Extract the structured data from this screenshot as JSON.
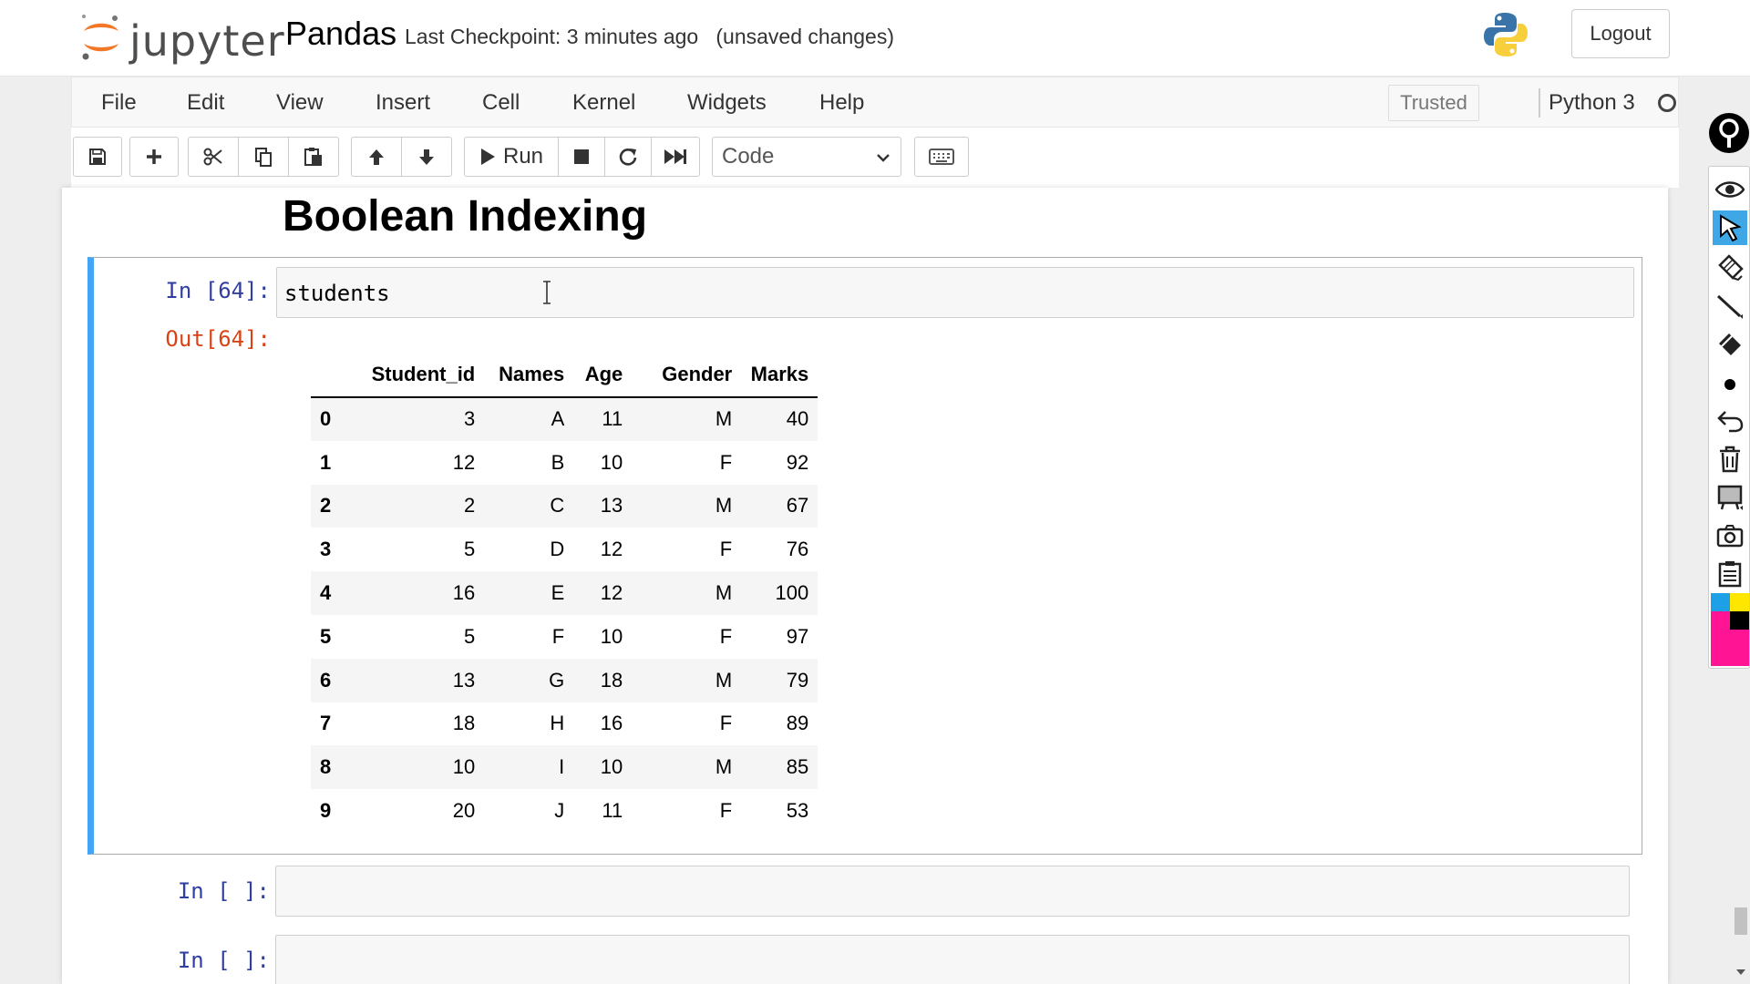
{
  "header": {
    "logo_text": "jupyter",
    "notebook_name": "Pandas",
    "checkpoint": "Last Checkpoint: 3 minutes ago",
    "unsaved": "(unsaved changes)",
    "logout_label": "Logout"
  },
  "menubar": {
    "items": [
      "File",
      "Edit",
      "View",
      "Insert",
      "Cell",
      "Kernel",
      "Widgets",
      "Help"
    ],
    "trusted_label": "Trusted",
    "kernel_name": "Python 3"
  },
  "toolbar": {
    "run_label": "Run",
    "cell_type": "Code"
  },
  "notebook": {
    "heading": "Boolean Indexing",
    "cells": [
      {
        "in_prompt": "In [64]:",
        "code": "students",
        "out_prompt": "Out[64]:"
      },
      {
        "in_prompt": "In [ ]:",
        "code": ""
      },
      {
        "in_prompt": "In [ ]:",
        "code": ""
      }
    ],
    "dataframe": {
      "columns": [
        "Student_id",
        "Names",
        "Age",
        "Gender",
        "Marks"
      ],
      "rows": [
        {
          "index": "0",
          "values": [
            "3",
            "A",
            "11",
            "M",
            "40"
          ]
        },
        {
          "index": "1",
          "values": [
            "12",
            "B",
            "10",
            "F",
            "92"
          ]
        },
        {
          "index": "2",
          "values": [
            "2",
            "C",
            "13",
            "M",
            "67"
          ]
        },
        {
          "index": "3",
          "values": [
            "5",
            "D",
            "12",
            "F",
            "76"
          ]
        },
        {
          "index": "4",
          "values": [
            "16",
            "E",
            "12",
            "M",
            "100"
          ]
        },
        {
          "index": "5",
          "values": [
            "5",
            "F",
            "10",
            "F",
            "97"
          ]
        },
        {
          "index": "6",
          "values": [
            "13",
            "G",
            "18",
            "M",
            "79"
          ]
        },
        {
          "index": "7",
          "values": [
            "18",
            "H",
            "16",
            "F",
            "89"
          ]
        },
        {
          "index": "8",
          "values": [
            "10",
            "I",
            "10",
            "M",
            "85"
          ]
        },
        {
          "index": "9",
          "values": [
            "20",
            "J",
            "11",
            "F",
            "53"
          ]
        }
      ]
    }
  },
  "colors": {
    "selected_cell_border": "#42a5f5",
    "in_prompt": "#303f9f",
    "out_prompt": "#d84315",
    "jupyter_orange": "#f37726",
    "palette": [
      "#1ea0e6",
      "#ffe600",
      "#ff1493",
      "#000000"
    ]
  },
  "icons": {
    "toolbar": [
      "save-icon",
      "plus-icon",
      "scissors-icon",
      "copy-icon",
      "paste-icon",
      "arrow-up-icon",
      "arrow-down-icon",
      "play-icon",
      "stop-icon",
      "restart-icon",
      "fast-forward-icon",
      "keyboard-icon"
    ],
    "draw_tools": [
      "eye-icon",
      "pointer-icon",
      "pen-icon",
      "line-icon",
      "eraser-icon",
      "dot-icon",
      "undo-icon",
      "trash-icon",
      "whiteboard-icon",
      "camera-icon",
      "clipboard-icon"
    ]
  }
}
